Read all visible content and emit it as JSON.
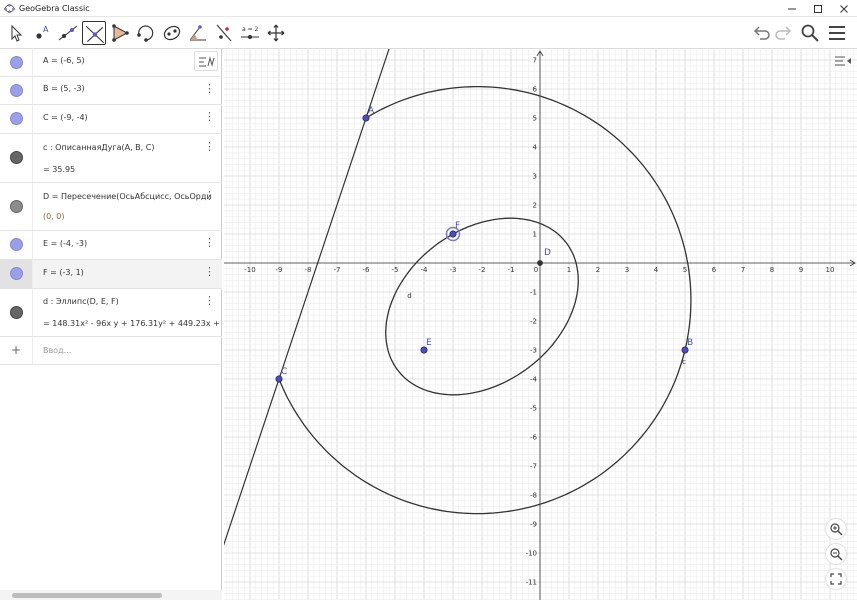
{
  "window": {
    "title": "GeoGebra Classic",
    "controls": [
      "minimize-icon",
      "maximize-icon",
      "close-icon"
    ]
  },
  "toolbar": {
    "tools": [
      {
        "name": "move-tool",
        "icon": "cursor-arrow-icon",
        "active": false
      },
      {
        "name": "point-tool",
        "icon": "point-a-icon",
        "active": false
      },
      {
        "name": "line-tool",
        "icon": "line-through-points-icon",
        "active": false
      },
      {
        "name": "perpendicular-line-tool",
        "icon": "perpendicular-line-icon",
        "active": true
      },
      {
        "name": "polygon-tool",
        "icon": "polygon-icon",
        "active": false
      },
      {
        "name": "circle-tool",
        "icon": "circular-arc-icon",
        "active": false
      },
      {
        "name": "conic-tool",
        "icon": "ellipse-icon",
        "active": false
      },
      {
        "name": "angle-tool",
        "icon": "angle-icon",
        "active": false
      },
      {
        "name": "reflect-tool",
        "icon": "reflect-about-line-icon",
        "active": false
      },
      {
        "name": "slider-tool",
        "icon": "slider-icon",
        "slider_text": "a = 2",
        "active": false
      },
      {
        "name": "move-graphics-tool",
        "icon": "move-graphics-view-icon",
        "active": false
      }
    ],
    "right_icons": [
      "undo-icon",
      "redo-icon",
      "search-icon",
      "menu-icon"
    ],
    "colors": {
      "active_border": "#333333",
      "tool_accent": "#6557d2",
      "point_blue": "#3333cc"
    }
  },
  "algebra": {
    "header_icon": "algebra-sort-icon",
    "rows": [
      {
        "definition": "A = (-6, 5)",
        "marble": "#9aa0e8",
        "selected": false,
        "has_menu": true
      },
      {
        "definition": "B = (5, -3)",
        "marble": "#9aa0e8",
        "selected": false,
        "has_menu": true
      },
      {
        "definition": "C = (-9, -4)",
        "marble": "#9aa0e8",
        "selected": false,
        "has_menu": true
      },
      {
        "definition": "c : ОписаннаяДуга(A, B, C)",
        "value": "=  35.95",
        "marble": "#666666",
        "selected": false,
        "has_menu": true
      },
      {
        "definition": "D  =  Пересечение(ОсьАбсцисс, ОсьОрди",
        "value": "(0, 0)",
        "marble": "#777777",
        "selected": false,
        "has_menu": true
      },
      {
        "definition": "E = (-4, -3)",
        "marble": "#9aa0e8",
        "selected": false,
        "has_menu": true
      },
      {
        "definition": "F = (-3, 1)",
        "marble": "#9aa0e8",
        "selected": true,
        "has_menu": true
      },
      {
        "definition": "d : Эллипс(D, E, F)",
        "value": "=  148.31x² - 96x y + 176.31y² + 449.23x +",
        "marble": "#666666",
        "selected": false,
        "has_menu": true
      }
    ],
    "input_placeholder": "Ввод..."
  },
  "graphics": {
    "x_ticks": [
      "-10",
      "-9",
      "-8",
      "-7",
      "-6",
      "-5",
      "-4",
      "-3",
      "-2",
      "-1",
      "0",
      "1",
      "2",
      "3",
      "4",
      "5",
      "6",
      "7",
      "8",
      "9",
      "10"
    ],
    "y_ticks": [
      "7",
      "6",
      "5",
      "4",
      "3",
      "2",
      "1",
      "-1",
      "-2",
      "-3",
      "-4",
      "-5",
      "-6",
      "-7",
      "-8",
      "-9",
      "-10",
      "-11"
    ],
    "point_labels": {
      "A": "A",
      "B": "B",
      "C": "C",
      "D": "D",
      "E": "E",
      "F": "F"
    },
    "curve_labels": {
      "arc": "c",
      "ellipse": "d"
    },
    "style_bar_icon": "graphics-style-bar-icon",
    "zoom_in_icon": "zoom-in-icon",
    "zoom_out_icon": "zoom-out-icon",
    "fullscreen_icon": "fullscreen-icon"
  }
}
